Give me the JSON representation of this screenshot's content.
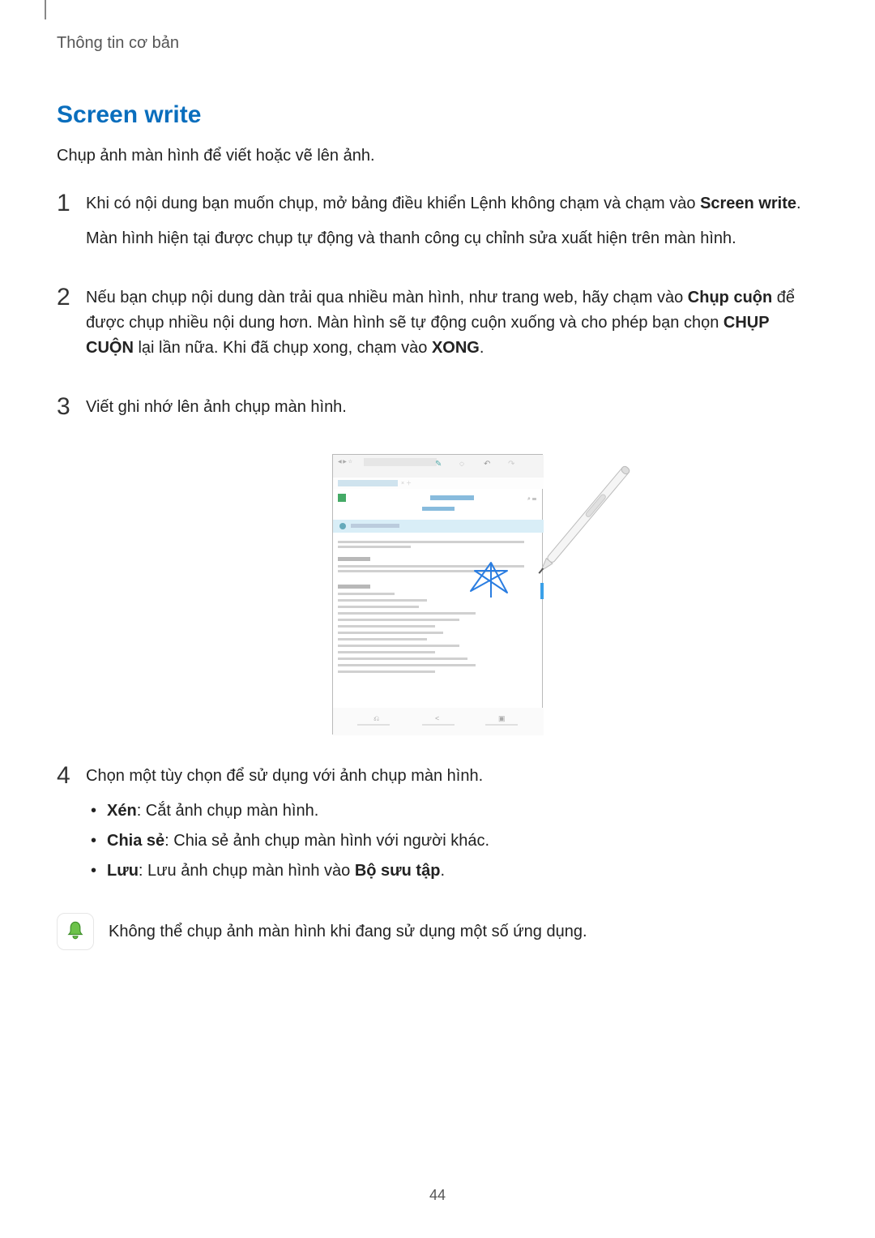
{
  "header": "Thông tin cơ bản",
  "sectionTitle": "Screen write",
  "intro": "Chụp ảnh màn hình để viết hoặc vẽ lên ảnh.",
  "steps": {
    "s1": {
      "num": "1",
      "p1a": "Khi có nội dung bạn muốn chụp, mở bảng điều khiển Lệnh không chạm và chạm vào ",
      "p1b": "Screen write",
      "p1c": ".",
      "p2": "Màn hình hiện tại được chụp tự động và thanh công cụ chỉnh sửa xuất hiện trên màn hình."
    },
    "s2": {
      "num": "2",
      "p1a": "Nếu bạn chụp nội dung dàn trải qua nhiều màn hình, như trang web, hãy chạm vào ",
      "p1b": "Chụp cuộn",
      "p1c": " để được chụp nhiều nội dung hơn. Màn hình sẽ tự động cuộn xuống và cho phép bạn chọn ",
      "p1d": "CHỤP CUỘN",
      "p1e": " lại lần nữa. Khi đã chụp xong, chạm vào ",
      "p1f": "XONG",
      "p1g": "."
    },
    "s3": {
      "num": "3",
      "p1": "Viết ghi nhớ lên ảnh chụp màn hình."
    },
    "s4": {
      "num": "4",
      "p1": "Chọn một tùy chọn để sử dụng với ảnh chụp màn hình.",
      "bullets": {
        "b1": {
          "bold": "Xén",
          "text": ": Cắt ảnh chụp màn hình."
        },
        "b2": {
          "bold": "Chia sẻ",
          "text": ": Chia sẻ ảnh chụp màn hình với người khác."
        },
        "b3": {
          "bold": "Lưu",
          "textA": ": Lưu ảnh chụp màn hình vào ",
          "textB": "Bộ sưu tập",
          "textC": "."
        }
      }
    }
  },
  "note": "Không thể chụp ảnh màn hình khi đang sử dụng một số ứng dụng.",
  "pageNumber": "44",
  "icons": {
    "bell": "bell-icon",
    "spen": "spen-icon",
    "scribble": "scribble-icon"
  }
}
